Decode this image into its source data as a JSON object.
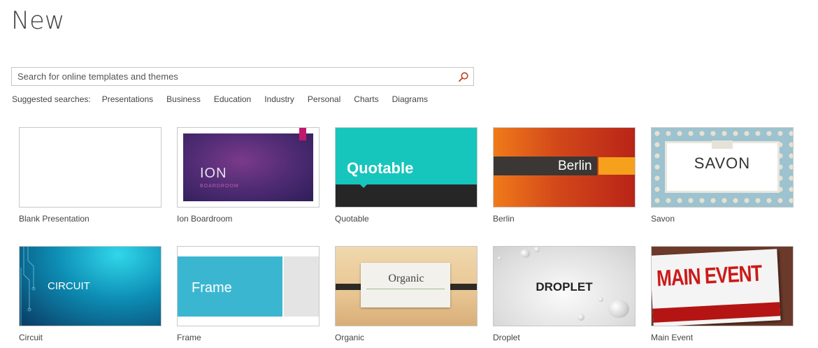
{
  "page": {
    "title": "New"
  },
  "search": {
    "placeholder": "Search for online templates and themes",
    "icon": "search-icon"
  },
  "suggested": {
    "label": "Suggested searches:",
    "items": [
      "Presentations",
      "Business",
      "Education",
      "Industry",
      "Personal",
      "Charts",
      "Diagrams"
    ]
  },
  "templates": [
    {
      "name": "Blank Presentation"
    },
    {
      "name": "Ion Boardroom",
      "thumb_title": "ION",
      "thumb_subtitle": "BOARDROOM"
    },
    {
      "name": "Quotable",
      "thumb_title": "Quotable"
    },
    {
      "name": "Berlin",
      "thumb_title": "Berlin"
    },
    {
      "name": "Savon",
      "thumb_title": "SAVON"
    },
    {
      "name": "Circuit",
      "thumb_title": "CIRCUIT"
    },
    {
      "name": "Frame",
      "thumb_title": "Frame"
    },
    {
      "name": "Organic",
      "thumb_title": "Organic"
    },
    {
      "name": "Droplet",
      "thumb_title": "DROPLET"
    },
    {
      "name": "Main Event",
      "thumb_title": "MAIN EVENT"
    }
  ],
  "colors": {
    "accent_search_icon": "#c43e1c",
    "quotable_teal": "#16c5bb",
    "ion_purple": "#4c2a72",
    "berlin_orange": "#f5a11b",
    "frame_blue": "#3bb6d0",
    "main_event_red": "#cc1a1a"
  }
}
